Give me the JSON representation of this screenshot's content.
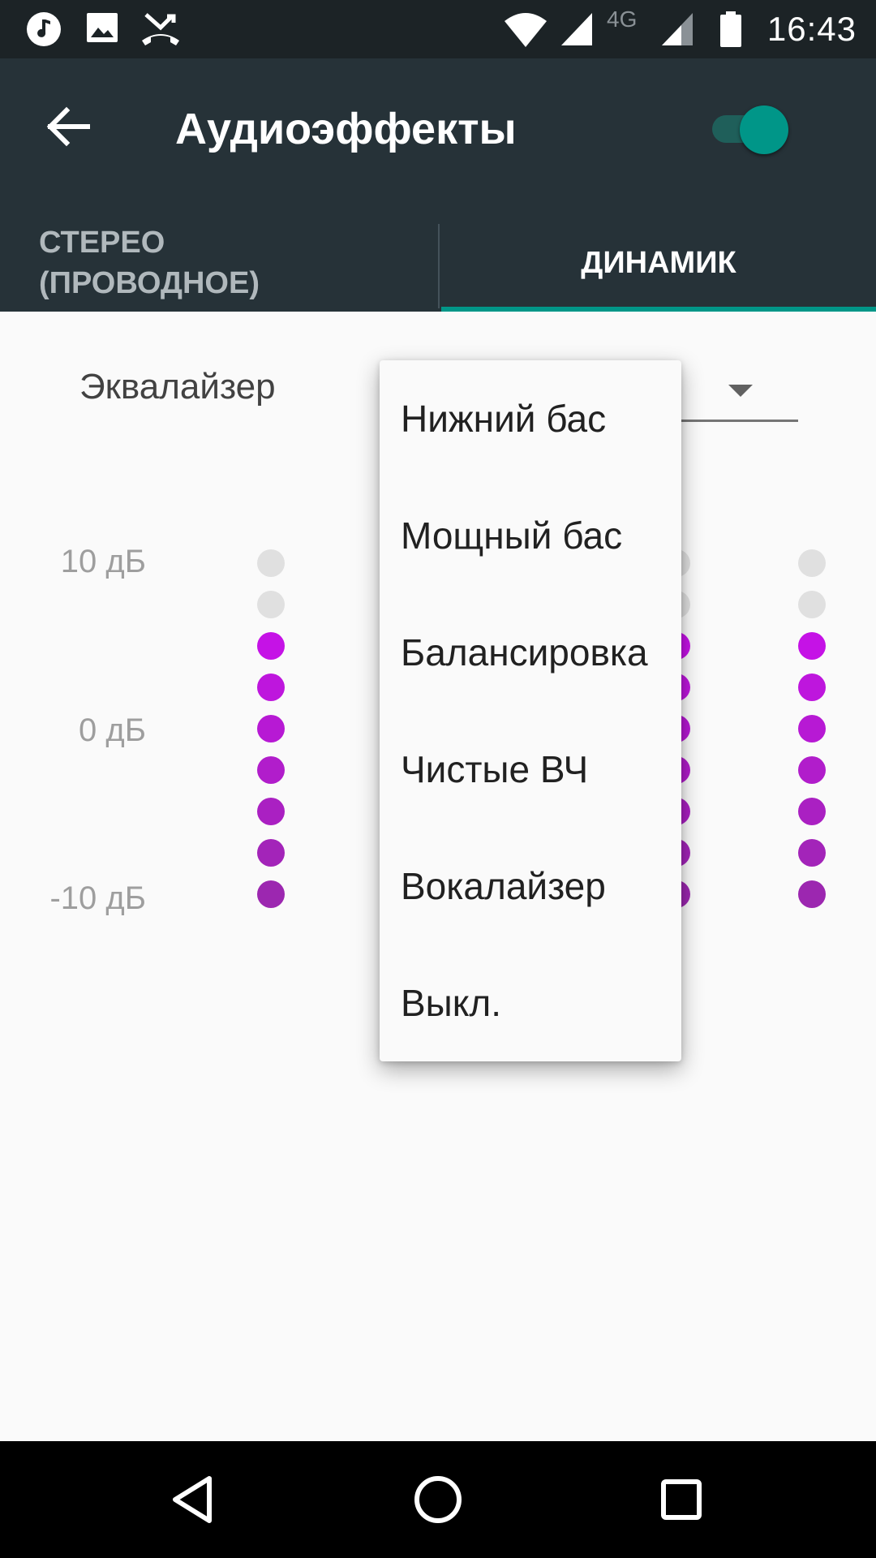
{
  "status_bar": {
    "time": "16:43",
    "network_label": "4G",
    "icons": [
      "music-note-icon",
      "image-icon",
      "missed-call-icon",
      "wifi-icon",
      "signal-icon",
      "signal-4g-icon",
      "battery-icon"
    ]
  },
  "app_bar": {
    "title": "Аудиоэффекты",
    "toggle_on": true,
    "back_icon": "arrow-back-icon"
  },
  "tabs": [
    {
      "label": "СТЕРЕО\n(ПРОВОДНОЕ)",
      "selected": false
    },
    {
      "label": "ДИНАМИК",
      "selected": true
    }
  ],
  "equalizer": {
    "label": "Эквалайзер",
    "db_labels": [
      "10 дБ",
      "0 дБ",
      "-10 дБ"
    ],
    "bands_active_dots": [
      7,
      7,
      7
    ]
  },
  "dropdown": {
    "items": [
      "Нижний бас",
      "Мощный бас",
      "Балансировка",
      "Чистые ВЧ",
      "Вокалайзер",
      "Выкл."
    ]
  },
  "colors": {
    "accent": "#009688",
    "app_bar": "#263238",
    "status_bar": "#1c2326",
    "dot_inactive": "#e0e0e0",
    "dot_active_top": "#c512e6",
    "dot_active_bottom": "#9c27b0"
  },
  "nav_bar": {
    "icons": [
      "back-triangle-icon",
      "home-circle-icon",
      "recents-square-icon"
    ]
  }
}
